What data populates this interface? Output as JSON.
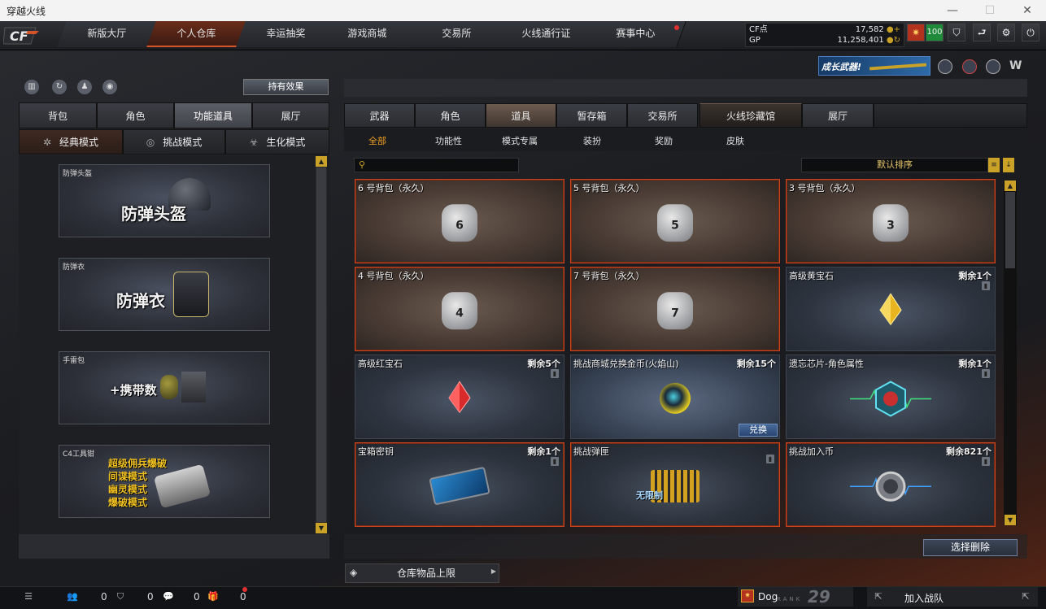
{
  "window": {
    "title": "穿越火线"
  },
  "nav": {
    "tabs": [
      {
        "label": "新版大厅"
      },
      {
        "label": "个人仓库"
      },
      {
        "label": "幸运抽奖"
      },
      {
        "label": "游戏商城"
      },
      {
        "label": "交易所"
      },
      {
        "label": "火线通行证"
      },
      {
        "label": "赛事中心"
      }
    ],
    "active_tab": "个人仓库",
    "currency": {
      "cf_label": "CF点",
      "cf_value": "17,582",
      "gp_label": "GP",
      "gp_value": "11,258,401"
    },
    "level_badge": "100"
  },
  "banner": {
    "text": "成长武器!"
  },
  "left": {
    "effect_button": "持有效果",
    "tabs": [
      {
        "label": "背包"
      },
      {
        "label": "角色"
      },
      {
        "label": "功能道具"
      },
      {
        "label": "展厅"
      }
    ],
    "active_tab": "功能道具",
    "mode_tabs": [
      {
        "label": "经典模式"
      },
      {
        "label": "挑战模式"
      },
      {
        "label": "生化模式"
      }
    ],
    "active_mode": "经典模式",
    "cards": [
      {
        "name": "防弹头盔",
        "big": "防弹头盔"
      },
      {
        "name": "防弹衣",
        "big": "防弹衣"
      },
      {
        "name": "手雷包",
        "big": "+携带数"
      },
      {
        "name": "C4工具钳",
        "big_lines": [
          "超级佣兵爆破",
          "间谍模式",
          "幽灵模式",
          "爆破模式"
        ]
      }
    ]
  },
  "right": {
    "tabs": [
      {
        "label": "武器"
      },
      {
        "label": "角色"
      },
      {
        "label": "道具"
      },
      {
        "label": "暂存箱"
      },
      {
        "label": "交易所"
      },
      {
        "label": "火线珍藏馆"
      },
      {
        "label": "展厅"
      }
    ],
    "active_tab": "道具",
    "subtabs": [
      {
        "label": "全部"
      },
      {
        "label": "功能性"
      },
      {
        "label": "模式专属"
      },
      {
        "label": "装扮"
      },
      {
        "label": "奖励"
      },
      {
        "label": "皮肤"
      }
    ],
    "active_subtab": "全部",
    "search_placeholder": "",
    "sort_label": "默认排序",
    "items": [
      {
        "name": "6 号背包（永久）",
        "remain": "",
        "icon": "bag-6-icon",
        "bag": "6",
        "selected": true
      },
      {
        "name": "5 号背包（永久）",
        "remain": "",
        "icon": "bag-5-icon",
        "bag": "5",
        "selected": true
      },
      {
        "name": "3 号背包（永久）",
        "remain": "",
        "icon": "bag-3-icon",
        "bag": "3",
        "selected": true
      },
      {
        "name": "4 号背包（永久）",
        "remain": "",
        "icon": "bag-4-icon",
        "bag": "4",
        "selected": true
      },
      {
        "name": "7 号背包（永久）",
        "remain": "",
        "icon": "bag-7-icon",
        "bag": "7",
        "selected": true
      },
      {
        "name": "高级黄宝石",
        "remain": "剩余1个",
        "icon": "yellow-gem-icon",
        "selected": false
      },
      {
        "name": "高级红宝石",
        "remain": "剩余5个",
        "icon": "red-gem-icon",
        "selected": false
      },
      {
        "name": "挑战商城兑换金币(火焰山)",
        "remain": "剩余15个",
        "icon": "gold-coin-icon",
        "selected": false,
        "exchange": "兑换"
      },
      {
        "name": "遗忘芯片-角色属性",
        "remain": "剩余1个",
        "icon": "chip-icon",
        "selected": false
      },
      {
        "name": "宝箱密钥",
        "remain": "剩余1个",
        "icon": "keycard-icon",
        "selected": true
      },
      {
        "name": "挑战弹匣",
        "remain": "",
        "icon": "ammo-icon",
        "sub": "无限制",
        "selected": true
      },
      {
        "name": "挑战加入币",
        "remain": "剩余821个",
        "icon": "join-coin-icon",
        "selected": true
      }
    ],
    "delete_button": "选择删除",
    "capacity_label": "仓库物品上限"
  },
  "status": {
    "c1": "0",
    "c2": "0",
    "c3": "0",
    "c4": "0",
    "username": "Dog",
    "rank_num": "29",
    "rank_text": "RANK",
    "join": "加入战队"
  }
}
